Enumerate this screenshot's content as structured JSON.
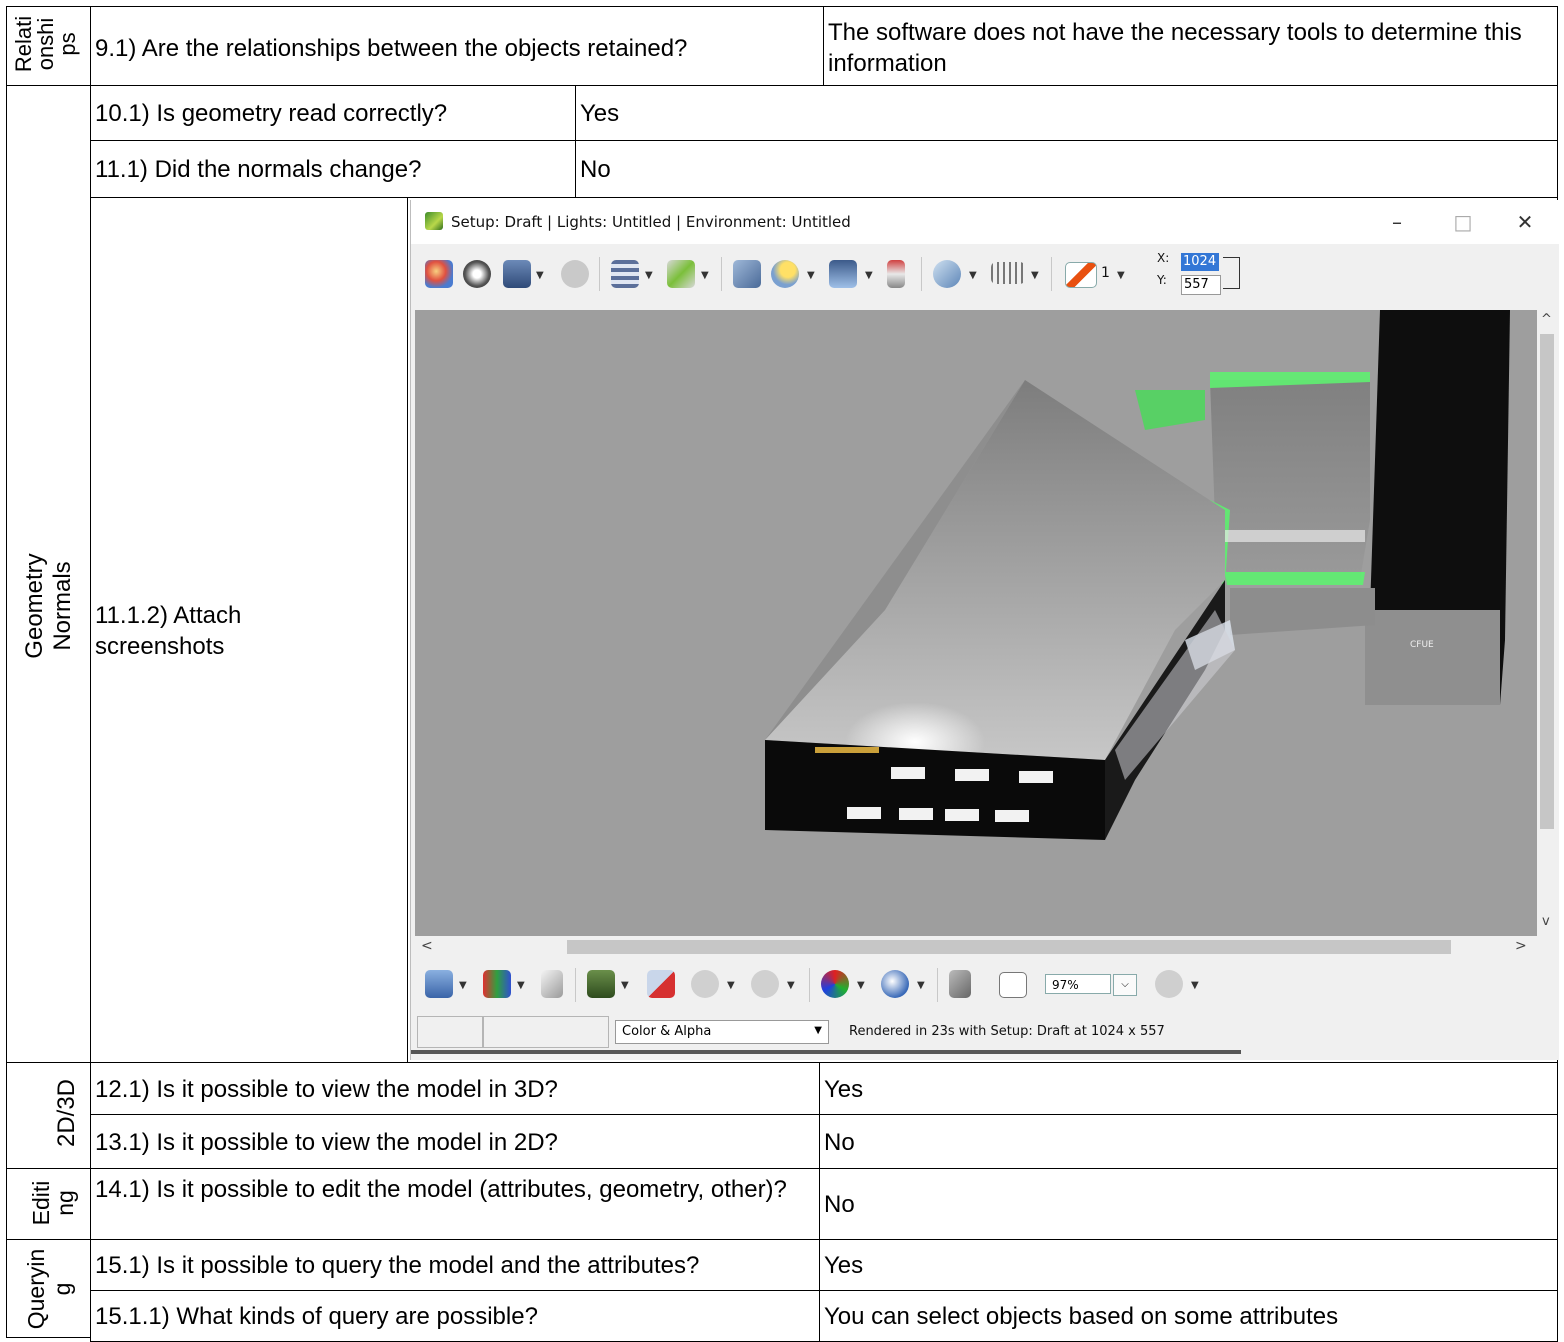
{
  "rows": [
    {
      "id": "r9",
      "group": "Relati\nonshi\nps",
      "question": "9.1) Are the relationships between the objects retained?",
      "answer": "The software does not have the necessary tools to determine this information"
    },
    {
      "id": "r10",
      "question": "10.1) Is geometry read correctly?",
      "answer": "Yes"
    },
    {
      "id": "r11",
      "question": "11.1) Did the normals change?",
      "answer": "No"
    },
    {
      "id": "r112",
      "question": "11.1.2) Attach screenshots"
    },
    {
      "id": "r12",
      "question": "12.1) Is it possible to view the model in 3D?",
      "answer": "Yes"
    },
    {
      "id": "r13",
      "question": "13.1) Is it possible to view the model in 2D?",
      "answer": "No"
    },
    {
      "id": "r14",
      "question": "14.1) Is it possible to edit the model (attributes, geometry, other)?",
      "answer": "No"
    },
    {
      "id": "r15",
      "question": "15.1) Is it possible to query the model and the attributes?",
      "answer": "Yes"
    },
    {
      "id": "r151",
      "question": "15.1.1) What kinds of query are possible?",
      "answer": "You can select objects based on some attributes"
    }
  ],
  "groups": {
    "relationships": "Relati\nonshi\nps",
    "geometry": "Geometry\nNormals",
    "dims": "2D/3D",
    "editing": "Editi\nng",
    "querying": "Queryin\ng"
  },
  "window": {
    "title": "Setup: Draft | Lights: Untitled | Environment: Untitled",
    "minimize": "–",
    "maximize": "□",
    "close": "✕",
    "x_label": "X:",
    "y_label": "Y:",
    "x_value": "1024",
    "y_value": "557",
    "passes": "1",
    "zoom": "97%",
    "channel": "Color & Alpha",
    "status": "Rendered in 23s with Setup: Draft at 1024 x 557",
    "scroll_up": "^",
    "scroll_down": "v",
    "scroll_left": "<",
    "scroll_right": ">",
    "building_sign": "CFUE"
  }
}
